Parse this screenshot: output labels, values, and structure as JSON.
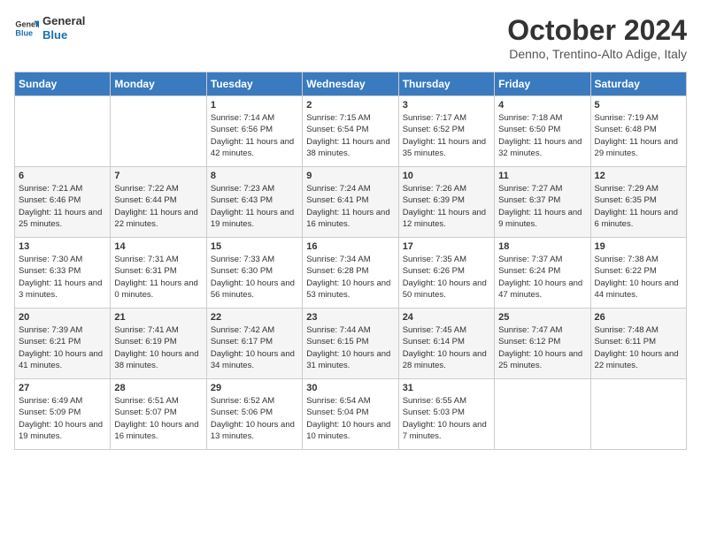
{
  "logo": {
    "line1": "General",
    "line2": "Blue"
  },
  "header": {
    "title": "October 2024",
    "subtitle": "Denno, Trentino-Alto Adige, Italy"
  },
  "weekdays": [
    "Sunday",
    "Monday",
    "Tuesday",
    "Wednesday",
    "Thursday",
    "Friday",
    "Saturday"
  ],
  "weeks": [
    [
      {
        "day": "",
        "info": ""
      },
      {
        "day": "",
        "info": ""
      },
      {
        "day": "1",
        "info": "Sunrise: 7:14 AM\nSunset: 6:56 PM\nDaylight: 11 hours and 42 minutes."
      },
      {
        "day": "2",
        "info": "Sunrise: 7:15 AM\nSunset: 6:54 PM\nDaylight: 11 hours and 38 minutes."
      },
      {
        "day": "3",
        "info": "Sunrise: 7:17 AM\nSunset: 6:52 PM\nDaylight: 11 hours and 35 minutes."
      },
      {
        "day": "4",
        "info": "Sunrise: 7:18 AM\nSunset: 6:50 PM\nDaylight: 11 hours and 32 minutes."
      },
      {
        "day": "5",
        "info": "Sunrise: 7:19 AM\nSunset: 6:48 PM\nDaylight: 11 hours and 29 minutes."
      }
    ],
    [
      {
        "day": "6",
        "info": "Sunrise: 7:21 AM\nSunset: 6:46 PM\nDaylight: 11 hours and 25 minutes."
      },
      {
        "day": "7",
        "info": "Sunrise: 7:22 AM\nSunset: 6:44 PM\nDaylight: 11 hours and 22 minutes."
      },
      {
        "day": "8",
        "info": "Sunrise: 7:23 AM\nSunset: 6:43 PM\nDaylight: 11 hours and 19 minutes."
      },
      {
        "day": "9",
        "info": "Sunrise: 7:24 AM\nSunset: 6:41 PM\nDaylight: 11 hours and 16 minutes."
      },
      {
        "day": "10",
        "info": "Sunrise: 7:26 AM\nSunset: 6:39 PM\nDaylight: 11 hours and 12 minutes."
      },
      {
        "day": "11",
        "info": "Sunrise: 7:27 AM\nSunset: 6:37 PM\nDaylight: 11 hours and 9 minutes."
      },
      {
        "day": "12",
        "info": "Sunrise: 7:29 AM\nSunset: 6:35 PM\nDaylight: 11 hours and 6 minutes."
      }
    ],
    [
      {
        "day": "13",
        "info": "Sunrise: 7:30 AM\nSunset: 6:33 PM\nDaylight: 11 hours and 3 minutes."
      },
      {
        "day": "14",
        "info": "Sunrise: 7:31 AM\nSunset: 6:31 PM\nDaylight: 11 hours and 0 minutes."
      },
      {
        "day": "15",
        "info": "Sunrise: 7:33 AM\nSunset: 6:30 PM\nDaylight: 10 hours and 56 minutes."
      },
      {
        "day": "16",
        "info": "Sunrise: 7:34 AM\nSunset: 6:28 PM\nDaylight: 10 hours and 53 minutes."
      },
      {
        "day": "17",
        "info": "Sunrise: 7:35 AM\nSunset: 6:26 PM\nDaylight: 10 hours and 50 minutes."
      },
      {
        "day": "18",
        "info": "Sunrise: 7:37 AM\nSunset: 6:24 PM\nDaylight: 10 hours and 47 minutes."
      },
      {
        "day": "19",
        "info": "Sunrise: 7:38 AM\nSunset: 6:22 PM\nDaylight: 10 hours and 44 minutes."
      }
    ],
    [
      {
        "day": "20",
        "info": "Sunrise: 7:39 AM\nSunset: 6:21 PM\nDaylight: 10 hours and 41 minutes."
      },
      {
        "day": "21",
        "info": "Sunrise: 7:41 AM\nSunset: 6:19 PM\nDaylight: 10 hours and 38 minutes."
      },
      {
        "day": "22",
        "info": "Sunrise: 7:42 AM\nSunset: 6:17 PM\nDaylight: 10 hours and 34 minutes."
      },
      {
        "day": "23",
        "info": "Sunrise: 7:44 AM\nSunset: 6:15 PM\nDaylight: 10 hours and 31 minutes."
      },
      {
        "day": "24",
        "info": "Sunrise: 7:45 AM\nSunset: 6:14 PM\nDaylight: 10 hours and 28 minutes."
      },
      {
        "day": "25",
        "info": "Sunrise: 7:47 AM\nSunset: 6:12 PM\nDaylight: 10 hours and 25 minutes."
      },
      {
        "day": "26",
        "info": "Sunrise: 7:48 AM\nSunset: 6:11 PM\nDaylight: 10 hours and 22 minutes."
      }
    ],
    [
      {
        "day": "27",
        "info": "Sunrise: 6:49 AM\nSunset: 5:09 PM\nDaylight: 10 hours and 19 minutes."
      },
      {
        "day": "28",
        "info": "Sunrise: 6:51 AM\nSunset: 5:07 PM\nDaylight: 10 hours and 16 minutes."
      },
      {
        "day": "29",
        "info": "Sunrise: 6:52 AM\nSunset: 5:06 PM\nDaylight: 10 hours and 13 minutes."
      },
      {
        "day": "30",
        "info": "Sunrise: 6:54 AM\nSunset: 5:04 PM\nDaylight: 10 hours and 10 minutes."
      },
      {
        "day": "31",
        "info": "Sunrise: 6:55 AM\nSunset: 5:03 PM\nDaylight: 10 hours and 7 minutes."
      },
      {
        "day": "",
        "info": ""
      },
      {
        "day": "",
        "info": ""
      }
    ]
  ]
}
